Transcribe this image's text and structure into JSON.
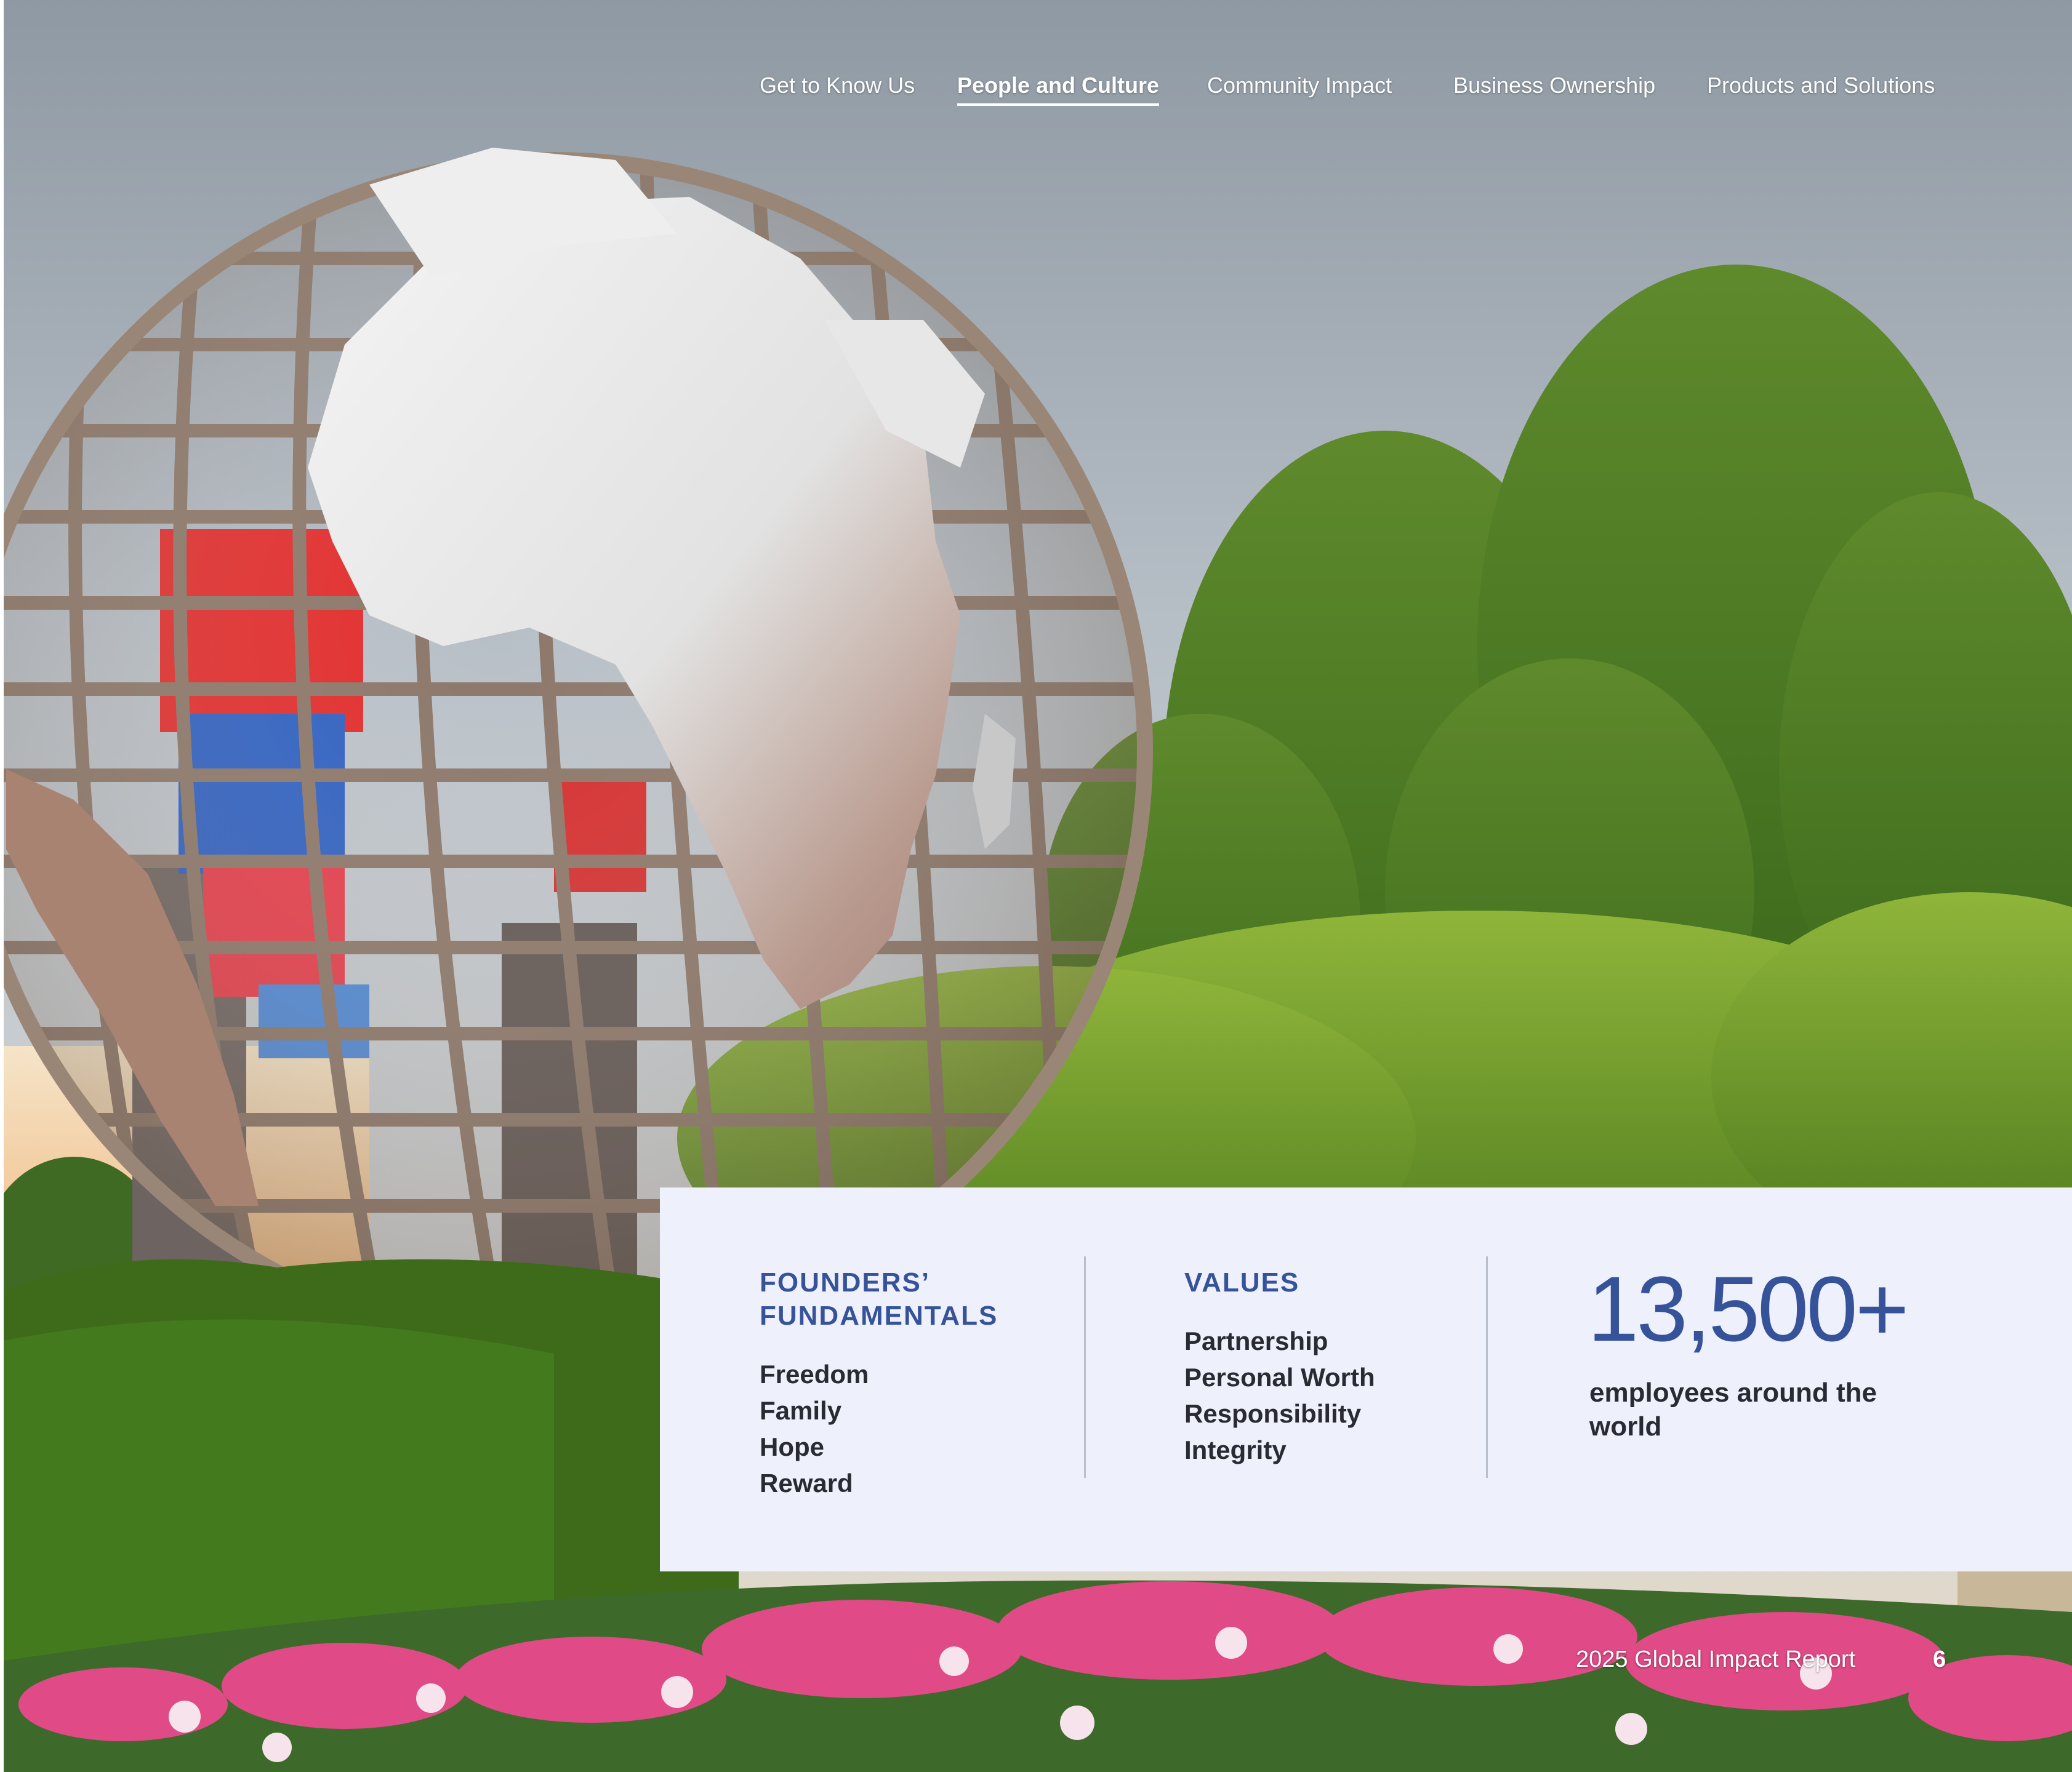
{
  "nav": {
    "items": [
      {
        "label": "Get to Know Us",
        "active": false
      },
      {
        "label": "People and Culture",
        "active": true
      },
      {
        "label": "Community Impact",
        "active": false
      },
      {
        "label": "Business Ownership",
        "active": false
      },
      {
        "label": "Products and Solutions",
        "active": false
      }
    ]
  },
  "card": {
    "founders": {
      "heading": "FOUNDERS’ FUNDAMENTALS",
      "items": [
        "Freedom",
        "Family",
        "Hope",
        "Reward"
      ]
    },
    "values": {
      "heading": "VALUES",
      "items": [
        "Partnership",
        "Personal Worth",
        "Responsibility",
        "Integrity"
      ]
    },
    "stat": {
      "number": "13,500+",
      "label": "employees around the world"
    }
  },
  "footer": {
    "report_title": "2025 Global Impact Report",
    "page_number": "6"
  },
  "colors": {
    "accent": "#36539a",
    "card_background": "#eef1fb",
    "body_text": "#2a2a33"
  },
  "image": {
    "icon": "globe-sculpture-photo"
  }
}
